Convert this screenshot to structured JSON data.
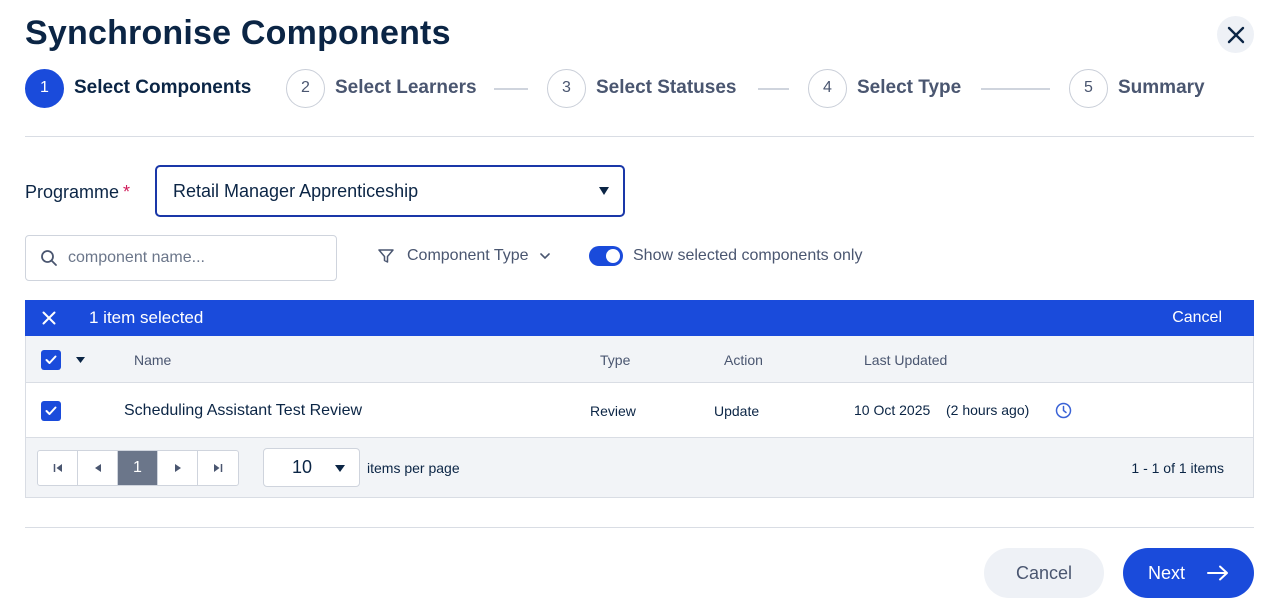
{
  "dialog": {
    "title": "Synchronise Components",
    "close_icon": "close-icon"
  },
  "stepper": {
    "steps": [
      {
        "number": "1",
        "label": "Select Components",
        "active": true
      },
      {
        "number": "2",
        "label": "Select Learners",
        "active": false
      },
      {
        "number": "3",
        "label": "Select Statuses",
        "active": false
      },
      {
        "number": "4",
        "label": "Select Type",
        "active": false
      },
      {
        "number": "5",
        "label": "Summary",
        "active": false
      }
    ]
  },
  "programme": {
    "label": "Programme",
    "required_marker": "*",
    "selected_value": "Retail Manager Apprenticeship"
  },
  "filters": {
    "search_placeholder": "component name...",
    "component_type_label": "Component Type",
    "show_selected_label": "Show selected components only",
    "show_selected_on": true
  },
  "selection_bar": {
    "count_text": "1 item selected",
    "cancel_label": "Cancel"
  },
  "table": {
    "columns": [
      "Name",
      "Type",
      "Action",
      "Last Updated"
    ],
    "rows": [
      {
        "selected": true,
        "name": "Scheduling Assistant Test Review",
        "type": "Review",
        "action": "Update",
        "last_updated_date": "10 Oct 2025",
        "last_updated_relative": "(2 hours ago)"
      }
    ]
  },
  "pagination": {
    "current_page": "1",
    "page_size": "10",
    "items_per_page_label": "items per page",
    "summary": "1 - 1 of 1 items"
  },
  "footer": {
    "cancel_label": "Cancel",
    "next_label": "Next"
  },
  "colors": {
    "primary": "#1a4bdb",
    "heading": "#0b2545",
    "required": "#d01b5a",
    "muted_bg": "#f2f4f7"
  }
}
